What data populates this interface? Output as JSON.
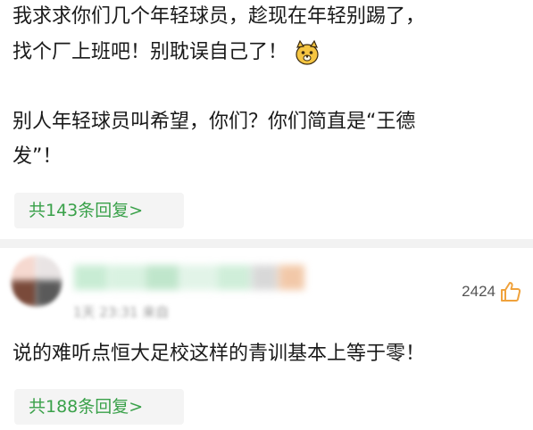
{
  "comment1": {
    "lines": [
      "我求求你们几个年轻球员，趁现在年轻别踢了，",
      "找个厂上班吧！别耽误自己了！",
      "别人年轻球员叫希望，你们？你们简直是“王德",
      "发”！"
    ],
    "emoji_icon": "dog-face-icon",
    "reply_label": "共143条回复>"
  },
  "comment2": {
    "author": "",
    "meta": "1天 23:31 来自",
    "likes": "2424",
    "like_icon": "thumbs-up-icon",
    "text": "说的难听点恒大足校这样的青训基本上等于零！",
    "reply_label": "共188条回复>"
  },
  "colors": {
    "reply_text": "#3aa14a",
    "reply_bg": "#f4f4f4",
    "like_icon": "#f0a23c",
    "divider": "#f2f2f2"
  }
}
